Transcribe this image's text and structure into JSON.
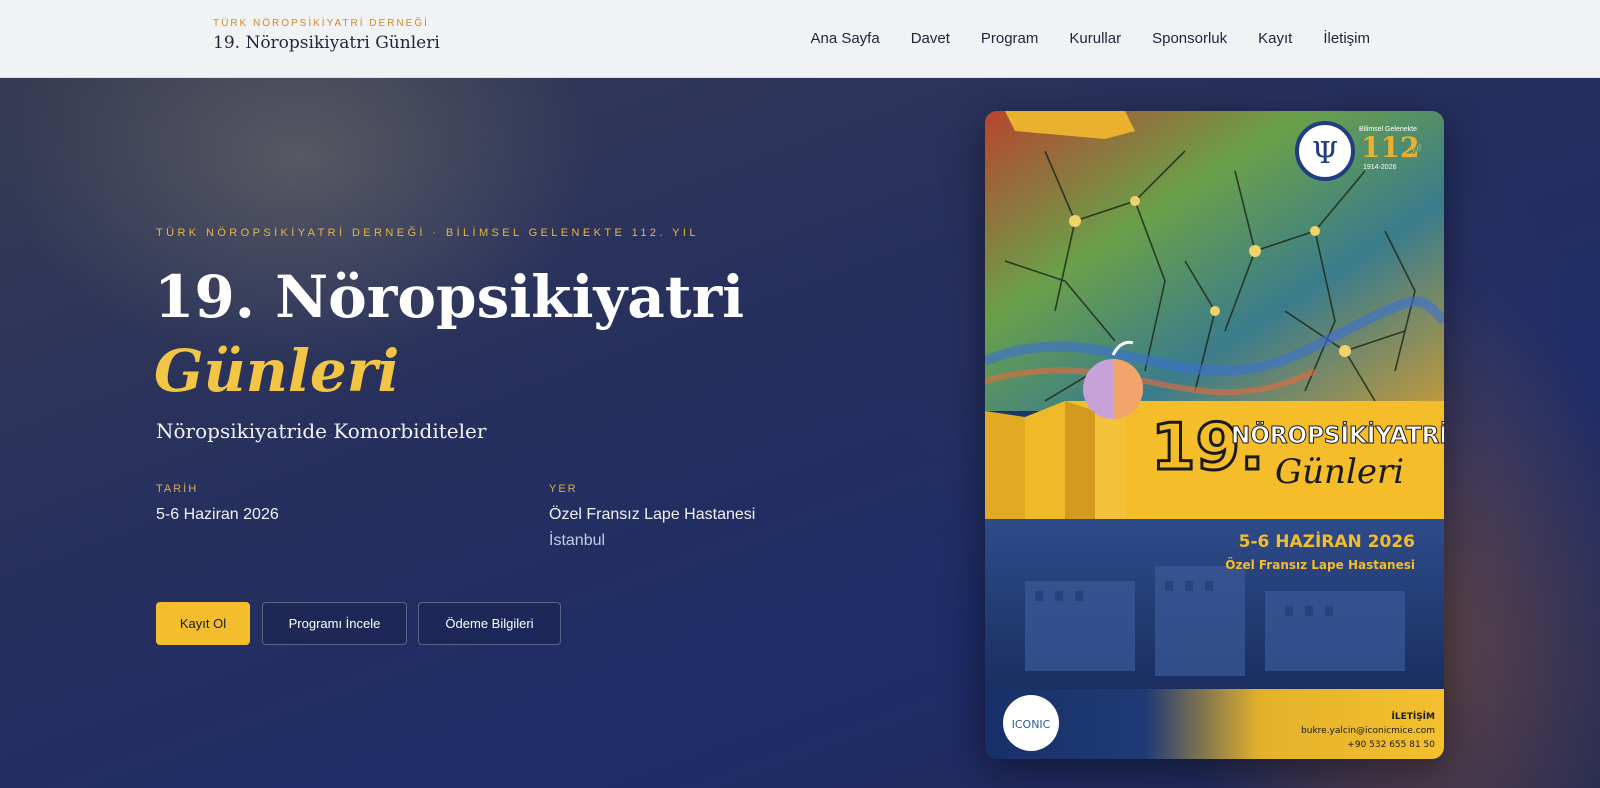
{
  "header": {
    "org": "TÜRK NÖROPSİKİYATRİ DERNEĞİ",
    "title": "19. Nöropsikiyatri Günleri",
    "nav": [
      "Ana Sayfa",
      "Davet",
      "Program",
      "Kurullar",
      "Sponsorluk",
      "Kayıt",
      "İletişim"
    ]
  },
  "hero": {
    "eyebrow": "TÜRK NÖROPSİKİYATRİ DERNEĞİ · BİLİMSEL GELENEKTE 112. YIL",
    "headline_line1": "19. Nöropsikiyatri",
    "headline_line2": "Günleri",
    "subtitle": "Nöropsikiyatride Komorbiditeler",
    "date_label": "TARİH",
    "date_value": "5-6 Haziran 2026",
    "venue_label": "YER",
    "venue_value": "Özel Fransız Lape Hastanesi",
    "venue_city": "İstanbul",
    "buttons": {
      "register": "Kayıt Ol",
      "program": "Programı İncele",
      "payment": "Ödeme Bilgileri"
    }
  },
  "poster": {
    "badge_small": "Bilimsel Gelenekte",
    "badge_years": "112",
    "badge_yil": "yıl",
    "badge_range": "1914-2026",
    "number": "19.",
    "title_top": "NÖROPSİKİYATRİ",
    "title_script": "Günleri",
    "date": "5-6 HAZİRAN 2026",
    "venue": "Özel Fransız Lape Hastanesi",
    "contact_label": "İLETİŞİM",
    "email": "bukre.yalcin@iconicmice.com",
    "phone": "+90 532 655 81 50",
    "logo_text": "ICONIC"
  },
  "colors": {
    "accent": "#f3c544",
    "primary_button": "#f3bd2d",
    "navy": "#1e2c68"
  }
}
